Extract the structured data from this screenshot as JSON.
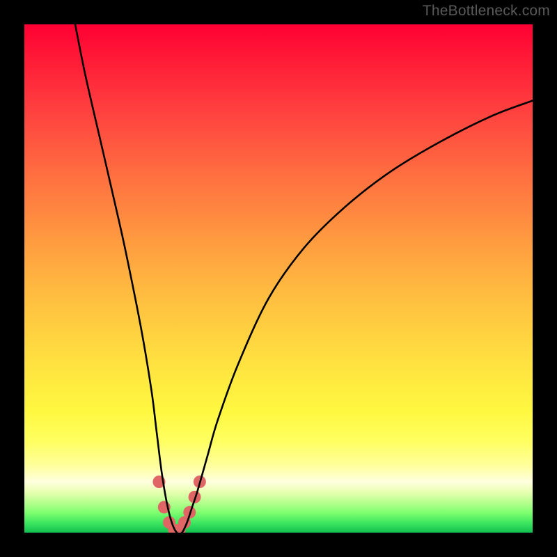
{
  "watermark": "TheBottleneck.com",
  "chart_data": {
    "type": "line",
    "title": "",
    "xlabel": "",
    "ylabel": "",
    "xlim": [
      0,
      100
    ],
    "ylim": [
      0,
      100
    ],
    "series": [
      {
        "name": "bottleneck-curve",
        "x": [
          10,
          12,
          15,
          18,
          20,
          23,
          25,
          26,
          27,
          28,
          29,
          30,
          31,
          32,
          33,
          34,
          36,
          38,
          42,
          48,
          55,
          63,
          72,
          82,
          92,
          100
        ],
        "y": [
          100,
          90,
          77,
          64,
          55,
          40,
          28,
          20,
          12,
          6,
          2,
          0,
          0,
          2,
          5,
          8,
          15,
          22,
          33,
          46,
          56,
          64,
          71,
          77,
          82,
          85
        ]
      }
    ],
    "markers": {
      "name": "highlight-points",
      "color": "#e06666",
      "x": [
        26.5,
        27.5,
        28.5,
        29.5,
        30.5,
        31.5,
        32.5,
        33.5,
        34.5
      ],
      "y": [
        10,
        5,
        2,
        0.5,
        0.5,
        2,
        4,
        7,
        10
      ],
      "radius": 9
    }
  }
}
